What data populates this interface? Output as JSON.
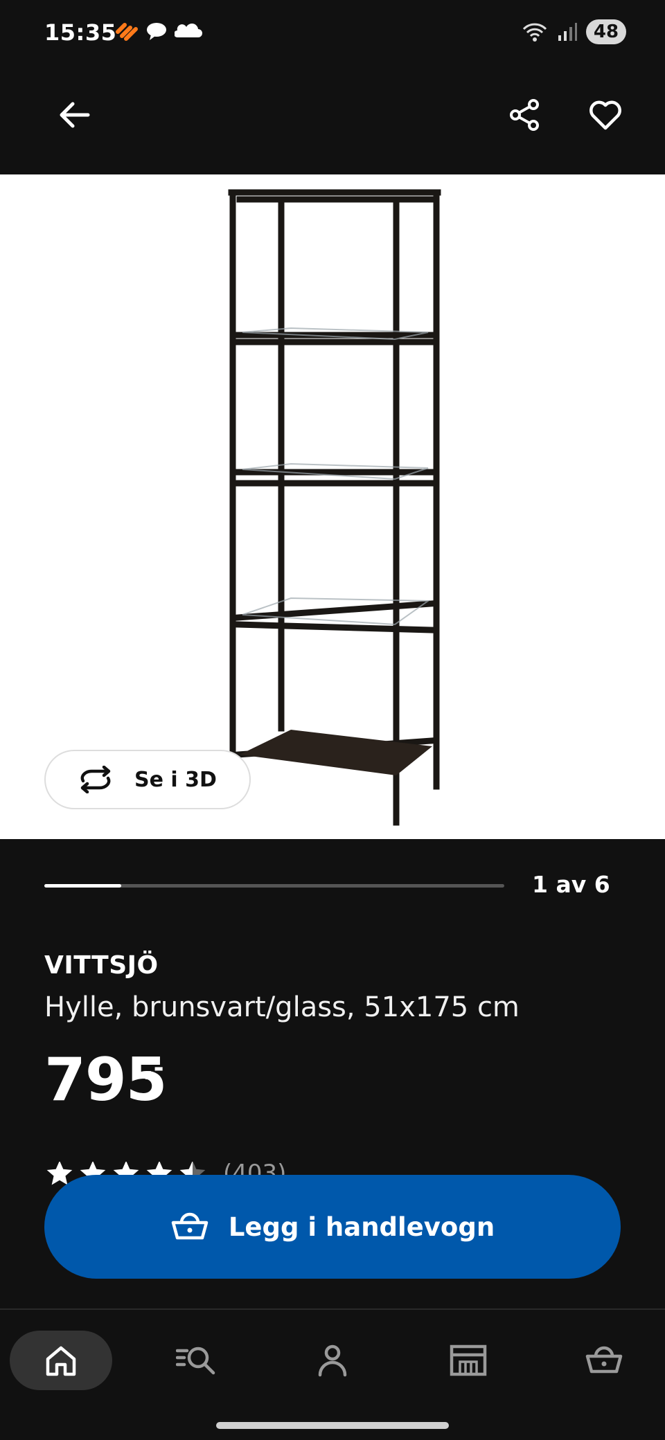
{
  "status_bar": {
    "time": "15:35",
    "battery": "48",
    "icons": [
      "app-notification-icon",
      "chat-icon",
      "cloud-icon",
      "wifi-icon",
      "signal-icon"
    ]
  },
  "top_nav": {
    "back_icon": "arrow-left-icon",
    "share_icon": "share-icon",
    "favorite_icon": "heart-icon"
  },
  "product": {
    "view_3d_label": "Se i 3D",
    "carousel": {
      "current": 1,
      "total": 6,
      "label": "1 av 6",
      "progress": 0.1667
    },
    "name": "VITTSJÖ",
    "description": "Hylle, brunsvart/glass, 51x175 cm",
    "price": "795",
    "price_suffix": ",-",
    "rating": {
      "stars": 4.5,
      "count_label": "(403)"
    }
  },
  "cta": {
    "label": "Legg i handlevogn",
    "icon": "basket-icon",
    "color": "#0058ab"
  },
  "bottom_nav": {
    "items": [
      {
        "name": "home",
        "icon": "home-icon",
        "active": true
      },
      {
        "name": "search",
        "icon": "search-list-icon",
        "active": false
      },
      {
        "name": "profile",
        "icon": "person-icon",
        "active": false
      },
      {
        "name": "stores",
        "icon": "store-icon",
        "active": false
      },
      {
        "name": "cart",
        "icon": "basket-icon",
        "active": false
      }
    ]
  }
}
